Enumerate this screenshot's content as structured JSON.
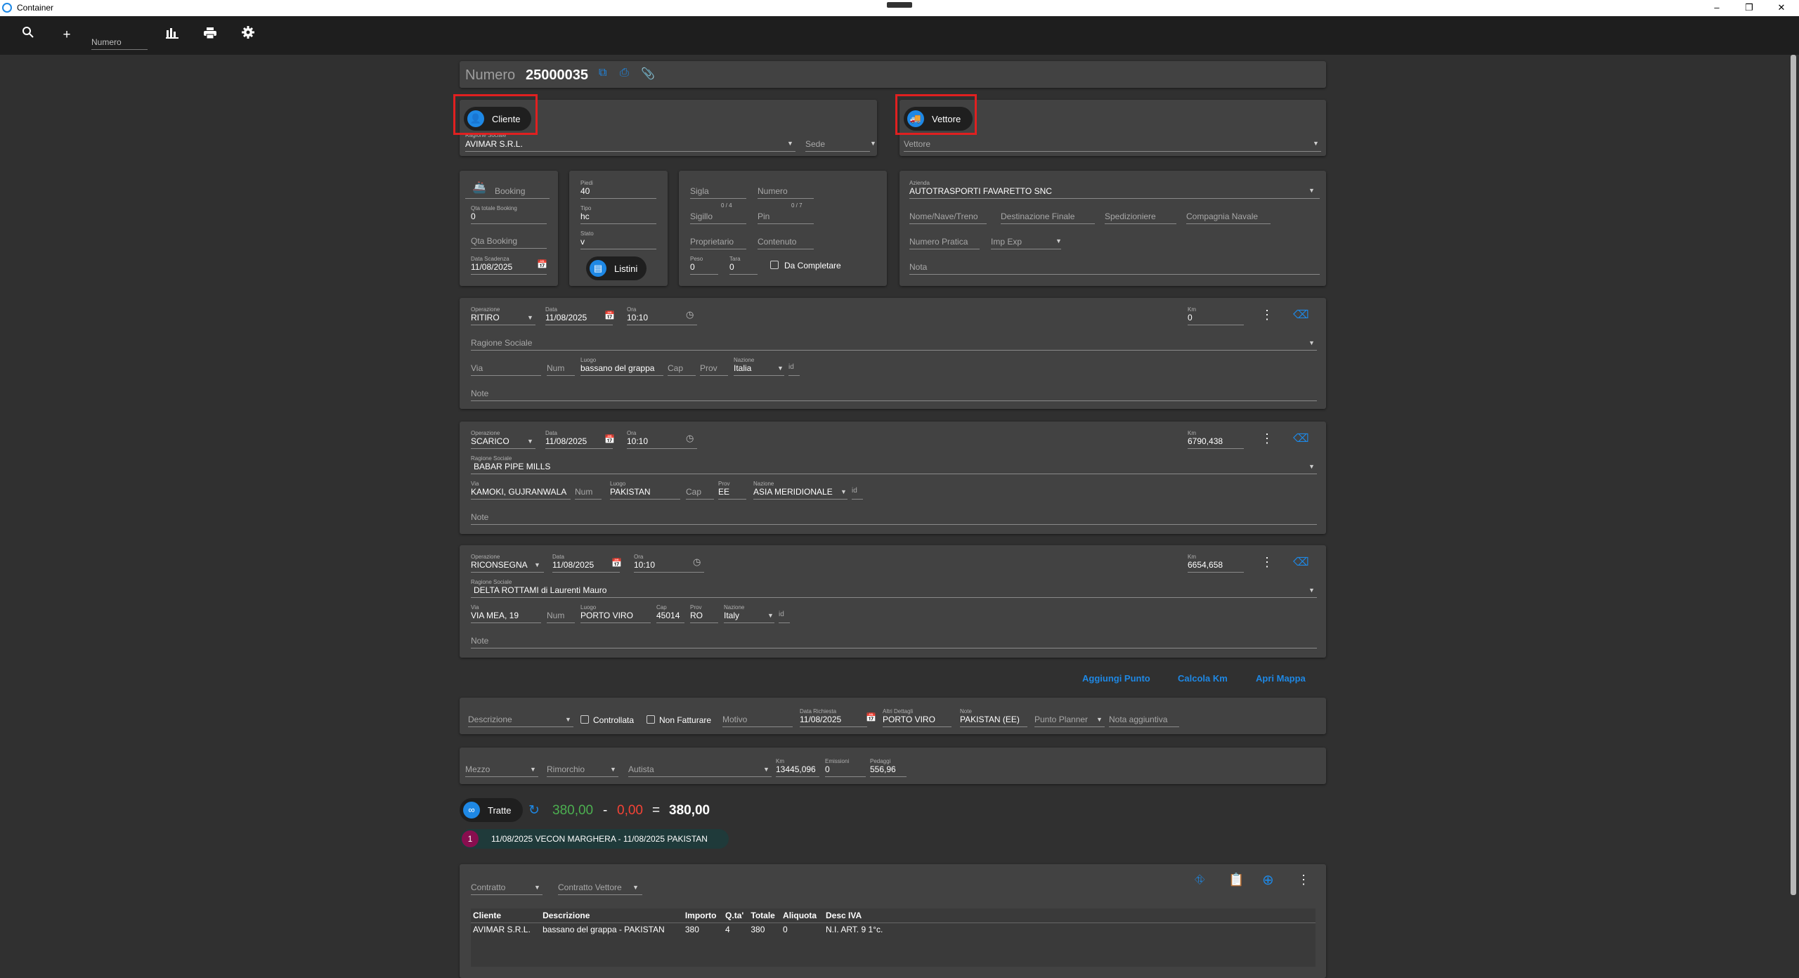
{
  "window": {
    "title": "Container",
    "minimize": "–",
    "restore": "❐",
    "close": "✕"
  },
  "toolbar": {
    "search_icon": "search-icon",
    "add_icon": "plus-icon",
    "numero_placeholder": "Numero",
    "chart_icon": "bar-chart-icon",
    "print_icon": "printer-icon",
    "settings_icon": "gear-icon"
  },
  "header": {
    "numero_label": "Numero",
    "numero_value": "25000035"
  },
  "cliente": {
    "button": "Cliente",
    "ragione_label": "Ragione Sociale",
    "ragione_value": "AVIMAR S.R.L.",
    "sede_placeholder": "Sede"
  },
  "vettore": {
    "button": "Vettore",
    "vettore_placeholder": "Vettore"
  },
  "booking": {
    "booking_label": "Booking",
    "qta_totale_label": "Qta totale Booking",
    "qta_totale_value": "0",
    "qta_booking_placeholder": "Qta Booking",
    "data_scadenza_label": "Data Scadenza",
    "data_scadenza_value": "11/08/2025"
  },
  "container": {
    "piedi_label": "Piedi",
    "piedi_value": "40",
    "tipo_label": "Tipo",
    "tipo_value": "hc",
    "stato_label": "Stato",
    "stato_value": "v",
    "listini_button": "Listini"
  },
  "sigla": {
    "sigla_placeholder": "Sigla",
    "numero_placeholder": "Numero",
    "sigla_count": "0 / 4",
    "numero_count": "0 / 7",
    "sigillo_placeholder": "Sigillo",
    "pin_placeholder": "Pin",
    "proprietario_placeholder": "Proprietario",
    "contenuto_placeholder": "Contenuto",
    "peso_label": "Peso",
    "peso_value": "0",
    "tara_label": "Tara",
    "tara_value": "0",
    "da_completare": "Da Completare"
  },
  "azienda": {
    "azienda_label": "Azienda",
    "azienda_value": "AUTOTRASPORTI FAVARETTO SNC",
    "nome_nave": "Nome/Nave/Treno",
    "destinazione": "Destinazione Finale",
    "spedizioniere": "Spedizioniere",
    "compagnia": "Compagnia Navale",
    "numero_pratica": "Numero Pratica",
    "imp_exp": "Imp Exp",
    "nota": "Nota"
  },
  "ritiro": {
    "operazione_label": "Operazione",
    "operazione_value": "RITIRO",
    "data_label": "Data",
    "data_value": "11/08/2025",
    "ora_label": "Ora",
    "ora_value": "10:10",
    "km_label": "Km",
    "km_value": "0",
    "ragione_placeholder": "Ragione Sociale",
    "via_placeholder": "Via",
    "num_placeholder": "Num",
    "luogo_label": "Luogo",
    "luogo_value": "bassano del grappa",
    "cap_placeholder": "Cap",
    "prov_placeholder": "Prov",
    "nazione_label": "Nazione",
    "nazione_value": "Italia",
    "id_placeholder": "id",
    "note_placeholder": "Note"
  },
  "scarico": {
    "operazione_label": "Operazione",
    "operazione_value": "SCARICO",
    "data_label": "Data",
    "data_value": "11/08/2025",
    "ora_label": "Ora",
    "ora_value": "10:10",
    "km_label": "Km",
    "km_value": "6790,438",
    "ragione_label": "Ragione Sociale",
    "ragione_value": "BABAR PIPE MILLS",
    "via_label": "Via",
    "via_value": "KAMOKI, GUJRANWALA",
    "num_placeholder": "Num",
    "luogo_label": "Luogo",
    "luogo_value": "PAKISTAN",
    "cap_placeholder": "Cap",
    "prov_label": "Prov",
    "prov_value": "EE",
    "nazione_label": "Nazione",
    "nazione_value": "ASIA MERIDIONALE",
    "id_placeholder": "id",
    "note_placeholder": "Note"
  },
  "riconsegna": {
    "operazione_label": "Operazione",
    "operazione_value": "RICONSEGNA",
    "data_label": "Data",
    "data_value": "11/08/2025",
    "ora_label": "Ora",
    "ora_value": "10:10",
    "km_label": "Km",
    "km_value": "6654,658",
    "ragione_label": "Ragione Sociale",
    "ragione_value": "DELTA ROTTAMI di Laurenti Mauro",
    "via_label": "Via",
    "via_value": "VIA MEA, 19",
    "num_placeholder": "Num",
    "luogo_label": "Luogo",
    "luogo_value": "PORTO VIRO",
    "cap_label": "Cap",
    "cap_value": "45014",
    "prov_label": "Prov",
    "prov_value": "RO",
    "nazione_label": "Nazione",
    "nazione_value": "Italy",
    "id_placeholder": "id",
    "note_placeholder": "Note"
  },
  "actions": {
    "aggiungi": "Aggiungi Punto",
    "calcola": "Calcola Km",
    "mappa": "Apri Mappa"
  },
  "details": {
    "descrizione": "Descrizione",
    "controllata": "Controllata",
    "non_fatturare": "Non Fatturare",
    "motivo": "Motivo",
    "data_richiesta_label": "Data Richiesta",
    "data_richiesta_value": "11/08/2025",
    "altri_label": "Altri Dettagli",
    "altri_value": "PORTO VIRO",
    "note_label": "Note",
    "note_value": "PAKISTAN (EE)",
    "punto_planner": "Punto Planner",
    "nota_aggiuntiva": "Nota aggiuntiva"
  },
  "mezzo": {
    "mezzo": "Mezzo",
    "rimorchio": "Rimorchio",
    "autista": "Autista",
    "km_label": "Km",
    "km_value": "13445,096",
    "emissioni_label": "Emissioni",
    "emissioni_value": "0",
    "pedaggi_label": "Pedaggi",
    "pedaggi_value": "556,96"
  },
  "tratte": {
    "button": "Tratte",
    "green_value": "380,00",
    "minus": "-",
    "red_value": "0,00",
    "equals": "=",
    "total": "380,00",
    "chip_index": "1",
    "chip_text": "11/08/2025 VECON MARGHERA - 11/08/2025 PAKISTAN"
  },
  "contratto": {
    "contratto": "Contratto",
    "contratto_vettore": "Contratto Vettore",
    "columns": [
      "Cliente",
      "Descrizione",
      "Importo",
      "Q.ta'",
      "Totale",
      "Aliquota",
      "Desc IVA"
    ],
    "rows": [
      [
        "AVIMAR S.R.L.",
        "bassano del grappa - PAKISTAN",
        "380",
        "4",
        "380",
        "0",
        "N.I. ART. 9 1°c."
      ]
    ]
  },
  "colors": {
    "accent": "#1e88e5",
    "green": "#4caf50",
    "red": "#f44336",
    "highlight": "#e02020"
  }
}
